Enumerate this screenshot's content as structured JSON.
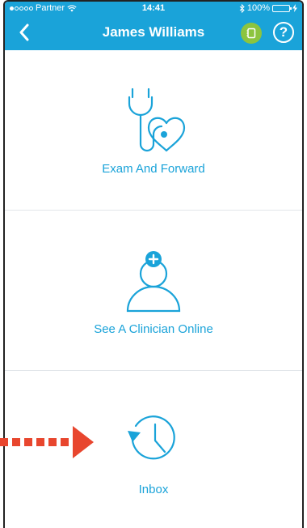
{
  "status_bar": {
    "carrier": "Partner",
    "time": "14:41",
    "battery": "100%"
  },
  "nav": {
    "title": "James Williams",
    "help_label": "?"
  },
  "menu": [
    {
      "label": "Exam And Forward",
      "icon": "stethoscope-heart-icon"
    },
    {
      "label": "See A Clinician Online",
      "icon": "clinician-add-icon"
    },
    {
      "label": "Inbox",
      "icon": "history-clock-icon"
    }
  ],
  "colors": {
    "primary": "#1aa3d9",
    "profile_badge": "#8cc43f",
    "annotation_arrow": "#e8462e"
  }
}
